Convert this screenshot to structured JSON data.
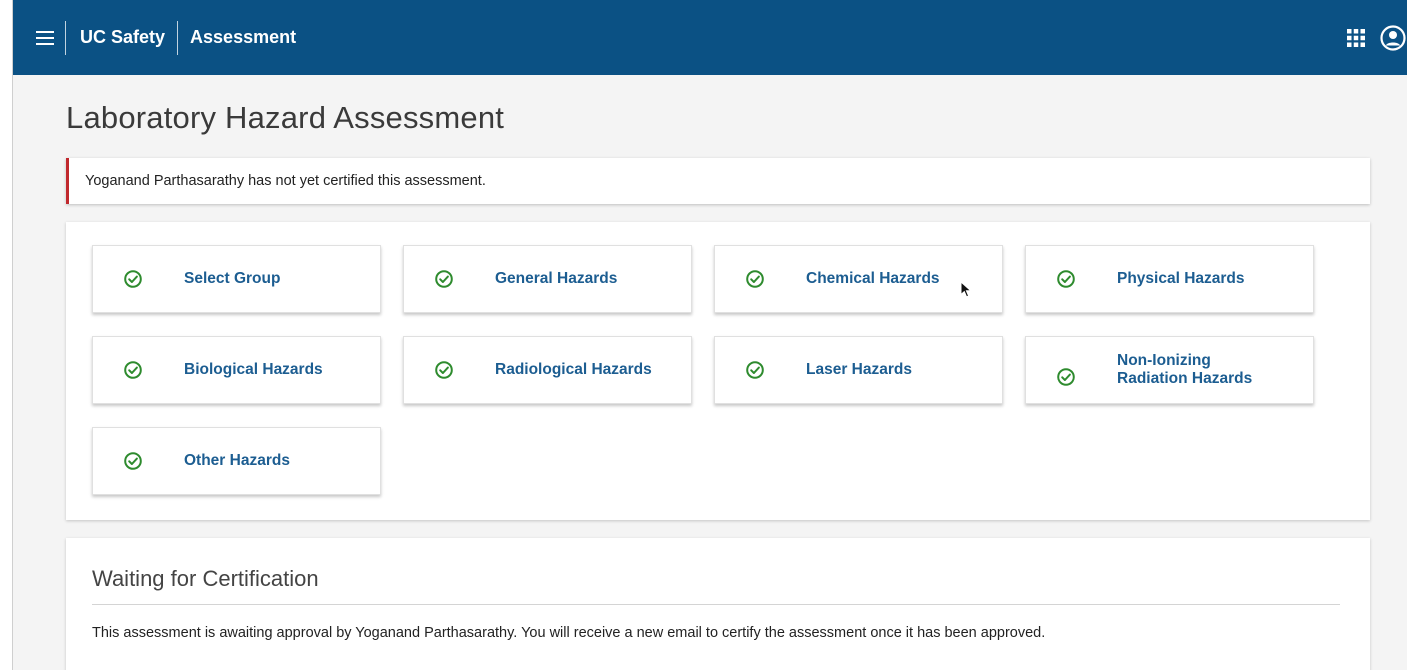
{
  "header": {
    "app_title": "UC Safety",
    "page_crumb": "Assessment",
    "bg_color": "#0b5184"
  },
  "icons": {
    "menu": "hamburger-menu-icon",
    "apps": "apps-grid-icon",
    "account": "account-circle-icon",
    "step_status": "check-circle-icon",
    "check_color": "#2e8b2e"
  },
  "main": {
    "title": "Laboratory Hazard Assessment",
    "alert_text": "Yoganand Parthasarathy has not yet certified this assessment.",
    "alert_color": "#c0282d",
    "steps": [
      {
        "label": "Select Group",
        "completed": true
      },
      {
        "label": "General Hazards",
        "completed": true
      },
      {
        "label": "Chemical Hazards",
        "completed": true
      },
      {
        "label": "Physical Hazards",
        "completed": true
      },
      {
        "label": "Biological Hazards",
        "completed": true
      },
      {
        "label": "Radiological Hazards",
        "completed": true
      },
      {
        "label": "Laser Hazards",
        "completed": true
      },
      {
        "label_line1": "Non-Ionizing",
        "label_line2": "Radiation Hazards",
        "completed": true
      },
      {
        "label": "Other Hazards",
        "completed": true
      }
    ]
  },
  "certification": {
    "title": "Waiting for Certification",
    "text": "This assessment is awaiting approval by Yoganand Parthasarathy. You will receive a new email to certify the assessment once it has been approved."
  }
}
